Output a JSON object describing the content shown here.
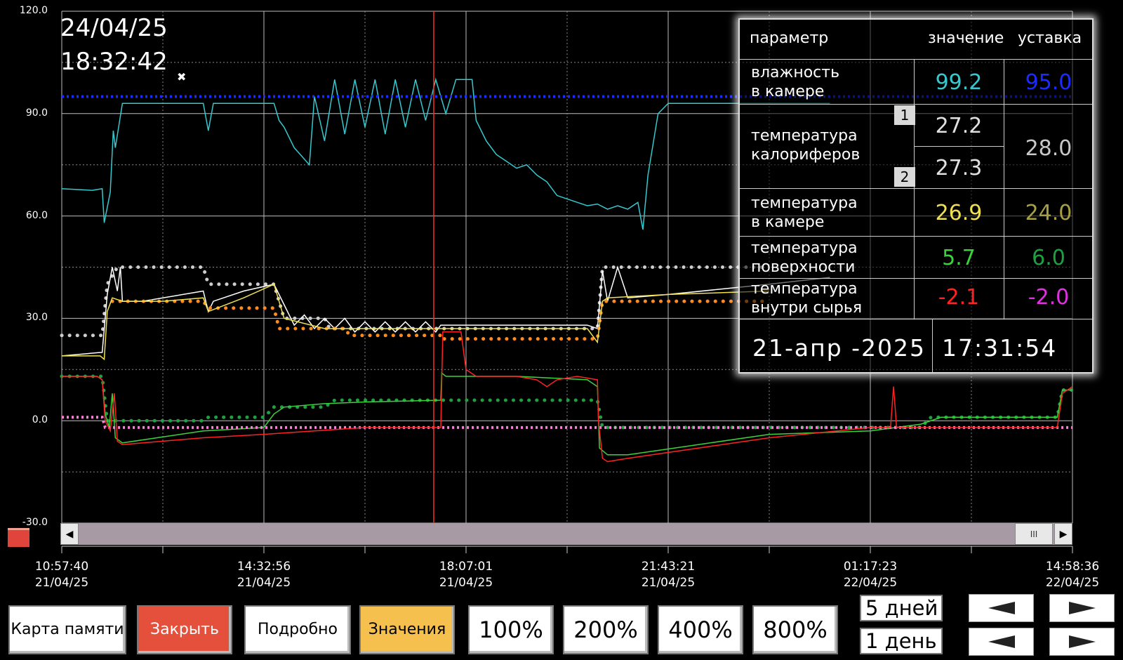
{
  "header": {
    "date": "24/04/25",
    "time": "18:32:42"
  },
  "colors": {
    "humidity": "#35c9cf",
    "humidity_setpoint": "#1c2bff",
    "heater": "#ffffff",
    "heater_setpoint": "#cccccc",
    "chamber_temp": "#f0e050",
    "chamber_setpoint": "#ff8a1e",
    "surface_temp": "#3bd23b",
    "surface_setpoint": "#1fa040",
    "inner_temp": "#ff2222",
    "inner_setpoint": "#ff7cd8",
    "cursor": "#ff2a1a"
  },
  "chart_data": {
    "type": "line",
    "ylim": [
      -30,
      120
    ],
    "y_ticks": [
      "120.0",
      "90.0",
      "60.0",
      "30.0",
      "0.0",
      "-30.0"
    ],
    "x_ticks": [
      {
        "time": "10:57:40",
        "date": "21/04/25"
      },
      {
        "time": "14:32:56",
        "date": "21/04/25"
      },
      {
        "time": "18:07:01",
        "date": "21/04/25"
      },
      {
        "time": "21:43:21",
        "date": "21/04/25"
      },
      {
        "time": "01:17:23",
        "date": "22/04/25"
      },
      {
        "time": "14:58:36",
        "date": "22/04/25"
      }
    ],
    "series": [
      {
        "key": "humidity",
        "style": "solid",
        "points": [
          [
            0,
            68
          ],
          [
            3,
            67.5
          ],
          [
            4,
            68
          ],
          [
            4.2,
            58
          ],
          [
            4.8,
            67
          ],
          [
            5.1,
            85
          ],
          [
            5.3,
            80
          ],
          [
            6,
            93
          ],
          [
            8,
            93
          ],
          [
            10,
            93
          ],
          [
            14,
            93
          ],
          [
            14.5,
            85
          ],
          [
            15,
            93
          ],
          [
            21,
            93
          ],
          [
            21.5,
            88
          ],
          [
            22,
            86
          ],
          [
            23,
            80
          ],
          [
            24.5,
            75
          ],
          [
            25,
            95
          ],
          [
            26,
            82
          ],
          [
            27,
            100
          ],
          [
            28,
            84
          ],
          [
            29,
            100
          ],
          [
            30,
            86
          ],
          [
            31,
            100
          ],
          [
            32,
            84
          ],
          [
            33,
            100
          ],
          [
            34,
            86
          ],
          [
            35,
            100
          ],
          [
            36,
            88
          ],
          [
            37,
            100
          ],
          [
            38,
            90
          ],
          [
            39,
            100
          ],
          [
            40,
            100
          ],
          [
            40.6,
            100
          ],
          [
            41,
            88
          ],
          [
            42,
            82
          ],
          [
            43,
            78
          ],
          [
            44,
            76
          ],
          [
            45,
            74
          ],
          [
            46,
            75
          ],
          [
            47,
            72
          ],
          [
            48,
            70
          ],
          [
            49,
            66
          ],
          [
            50,
            65
          ],
          [
            51,
            64
          ],
          [
            52,
            63
          ],
          [
            53,
            63.5
          ],
          [
            54,
            62
          ],
          [
            55,
            63
          ],
          [
            56,
            62
          ],
          [
            57,
            64
          ],
          [
            57.5,
            56
          ],
          [
            58,
            72
          ],
          [
            59,
            90
          ],
          [
            60,
            93
          ],
          [
            70,
            93
          ],
          [
            76,
            93
          ]
        ]
      },
      {
        "key": "humidity_setpoint",
        "style": "dotted",
        "points": [
          [
            0,
            95
          ],
          [
            100,
            95
          ]
        ]
      },
      {
        "key": "heater_setpoint",
        "style": "dots",
        "points": [
          [
            0,
            25
          ],
          [
            4,
            25
          ],
          [
            4.5,
            40
          ],
          [
            5.5,
            45
          ],
          [
            14,
            45
          ],
          [
            14.5,
            40
          ],
          [
            21,
            40
          ],
          [
            22,
            30
          ],
          [
            26,
            30
          ],
          [
            26.5,
            27
          ],
          [
            37.5,
            27
          ],
          [
            37.5,
            27
          ],
          [
            52,
            27
          ],
          [
            53,
            27
          ],
          [
            53.5,
            45
          ],
          [
            70,
            45
          ]
        ]
      },
      {
        "key": "heater",
        "style": "solid",
        "points": [
          [
            0,
            19
          ],
          [
            3.8,
            20
          ],
          [
            4,
            20
          ],
          [
            4.5,
            37
          ],
          [
            5,
            45
          ],
          [
            5.5,
            38
          ],
          [
            5.8,
            45
          ],
          [
            6,
            35
          ],
          [
            8,
            35
          ],
          [
            10,
            36
          ],
          [
            14,
            38
          ],
          [
            14.5,
            32
          ],
          [
            15,
            35
          ],
          [
            18,
            38
          ],
          [
            21,
            40
          ],
          [
            22,
            34
          ],
          [
            23,
            28
          ],
          [
            24,
            31
          ],
          [
            25,
            27
          ],
          [
            26,
            30
          ],
          [
            27,
            27
          ],
          [
            28,
            30
          ],
          [
            29,
            26
          ],
          [
            30,
            29
          ],
          [
            31,
            26
          ],
          [
            32,
            29
          ],
          [
            33,
            26
          ],
          [
            34,
            29
          ],
          [
            35,
            26
          ],
          [
            36,
            29
          ],
          [
            37,
            26
          ],
          [
            37.5,
            28
          ],
          [
            52,
            28
          ],
          [
            53,
            27
          ],
          [
            53.5,
            44
          ],
          [
            54,
            35
          ],
          [
            55,
            45
          ],
          [
            56,
            36
          ],
          [
            60,
            37
          ],
          [
            70,
            40
          ],
          [
            76,
            42
          ]
        ]
      },
      {
        "key": "chamber_setpoint",
        "style": "dots",
        "points": [
          [
            5,
            35
          ],
          [
            14,
            35
          ],
          [
            14.5,
            33
          ],
          [
            21,
            33
          ],
          [
            21.5,
            27
          ],
          [
            28,
            27
          ],
          [
            28.5,
            25
          ],
          [
            37.5,
            25
          ],
          [
            37.5,
            24
          ],
          [
            52,
            24
          ],
          [
            53,
            24
          ],
          [
            53.5,
            35
          ],
          [
            70,
            35
          ]
        ]
      },
      {
        "key": "chamber_temp",
        "style": "solid",
        "points": [
          [
            0,
            19
          ],
          [
            3.8,
            19
          ],
          [
            4.2,
            18
          ],
          [
            4.5,
            32
          ],
          [
            5,
            36
          ],
          [
            6,
            35
          ],
          [
            10,
            35
          ],
          [
            14,
            36
          ],
          [
            14.5,
            32
          ],
          [
            18,
            36
          ],
          [
            21,
            40
          ],
          [
            22,
            30
          ],
          [
            26,
            27
          ],
          [
            37.5,
            27
          ],
          [
            52,
            27
          ],
          [
            53,
            23
          ],
          [
            53.5,
            35
          ],
          [
            54,
            36
          ],
          [
            60,
            37
          ],
          [
            70,
            38
          ]
        ]
      },
      {
        "key": "surface_setpoint",
        "style": "dots",
        "points": [
          [
            0,
            13
          ],
          [
            4,
            13
          ],
          [
            4.5,
            0
          ],
          [
            14,
            0
          ],
          [
            14.5,
            1
          ],
          [
            20,
            1
          ],
          [
            21,
            4
          ],
          [
            26,
            4
          ],
          [
            27,
            6
          ],
          [
            40,
            6
          ],
          [
            52,
            6
          ],
          [
            53,
            6
          ],
          [
            53.5,
            -2
          ],
          [
            80,
            -2
          ],
          [
            85,
            -2
          ],
          [
            86,
            1
          ],
          [
            98.5,
            1
          ],
          [
            99,
            9
          ],
          [
            100,
            9
          ]
        ]
      },
      {
        "key": "surface_temp",
        "style": "solid",
        "points": [
          [
            0,
            13
          ],
          [
            3.5,
            13
          ],
          [
            4,
            12
          ],
          [
            4.3,
            2
          ],
          [
            4.7,
            -2
          ],
          [
            5,
            8
          ],
          [
            5.3,
            -5
          ],
          [
            6,
            -6.5
          ],
          [
            14,
            -3
          ],
          [
            20,
            -2
          ],
          [
            21,
            2
          ],
          [
            22,
            4
          ],
          [
            26,
            5
          ],
          [
            30,
            5.5
          ],
          [
            37.5,
            6
          ],
          [
            37.6,
            14
          ],
          [
            38,
            13
          ],
          [
            41,
            13
          ],
          [
            45,
            13
          ],
          [
            52,
            12
          ],
          [
            53,
            10
          ],
          [
            53.2,
            -8
          ],
          [
            54,
            -10
          ],
          [
            56,
            -10
          ],
          [
            70,
            -4
          ],
          [
            80,
            -3
          ],
          [
            85,
            -1
          ],
          [
            87,
            1
          ],
          [
            98.5,
            1
          ],
          [
            99,
            9
          ],
          [
            100,
            9
          ]
        ]
      },
      {
        "key": "inner_setpoint",
        "style": "dotted",
        "points": [
          [
            0,
            1
          ],
          [
            4,
            1
          ],
          [
            4.3,
            -2
          ],
          [
            100,
            -2
          ]
        ]
      },
      {
        "key": "inner_temp",
        "style": "solid",
        "points": [
          [
            0,
            13
          ],
          [
            3.5,
            13
          ],
          [
            4,
            12
          ],
          [
            4.3,
            0
          ],
          [
            4.8,
            -3
          ],
          [
            5.2,
            8
          ],
          [
            5.5,
            -6
          ],
          [
            6,
            -7
          ],
          [
            14,
            -5
          ],
          [
            20,
            -4
          ],
          [
            30,
            -2
          ],
          [
            37.5,
            -2
          ],
          [
            37.7,
            26
          ],
          [
            38,
            26
          ],
          [
            39.5,
            26
          ],
          [
            40,
            15
          ],
          [
            41,
            13
          ],
          [
            45,
            13
          ],
          [
            47,
            12
          ],
          [
            48,
            10
          ],
          [
            49,
            12
          ],
          [
            51,
            13
          ],
          [
            53,
            12
          ],
          [
            53.1,
            0
          ],
          [
            53.5,
            -11
          ],
          [
            54,
            -12
          ],
          [
            56,
            -11
          ],
          [
            70,
            -5
          ],
          [
            80,
            -2
          ],
          [
            82,
            -2
          ],
          [
            82.3,
            10
          ],
          [
            82.6,
            -2
          ],
          [
            85,
            -2
          ],
          [
            98.5,
            -2
          ],
          [
            99,
            8
          ],
          [
            100,
            10
          ]
        ]
      }
    ],
    "cursor_x": 36.8
  },
  "panel": {
    "headers": [
      "параметр",
      "значение",
      "уставка"
    ],
    "rows": {
      "humidity": {
        "label1": "влажность",
        "label2": "в камере",
        "value": "99.2",
        "setpoint": "95.0"
      },
      "heater": {
        "label1": "температура",
        "label2": "калориферов",
        "value1": "27.2",
        "value2": "27.3",
        "setpoint": "28.0",
        "badge1": "1",
        "badge2": "2"
      },
      "chamber": {
        "label1": "температура",
        "label2": "в камере",
        "value": "26.9",
        "setpoint": "24.0"
      },
      "surface": {
        "label1": "температура",
        "label2": "поверхности",
        "value": "5.7",
        "setpoint": "6.0"
      },
      "inner": {
        "label1": "температура",
        "label2": "внутри сырья",
        "value": "-2.1",
        "setpoint": "-2.0"
      }
    },
    "footer_date": "21-апр -2025",
    "footer_time": "17:31:54"
  },
  "scrollbar": {
    "thumb_label": "III"
  },
  "buttons": {
    "memory_map": "Карта памяти",
    "close": "Закрыть",
    "details": "Подробно",
    "values": "Значения",
    "zoom100": "100%",
    "zoom200": "200%",
    "zoom400": "400%",
    "zoom800": "800%",
    "range5": "5 дней",
    "range1": "1 день"
  }
}
